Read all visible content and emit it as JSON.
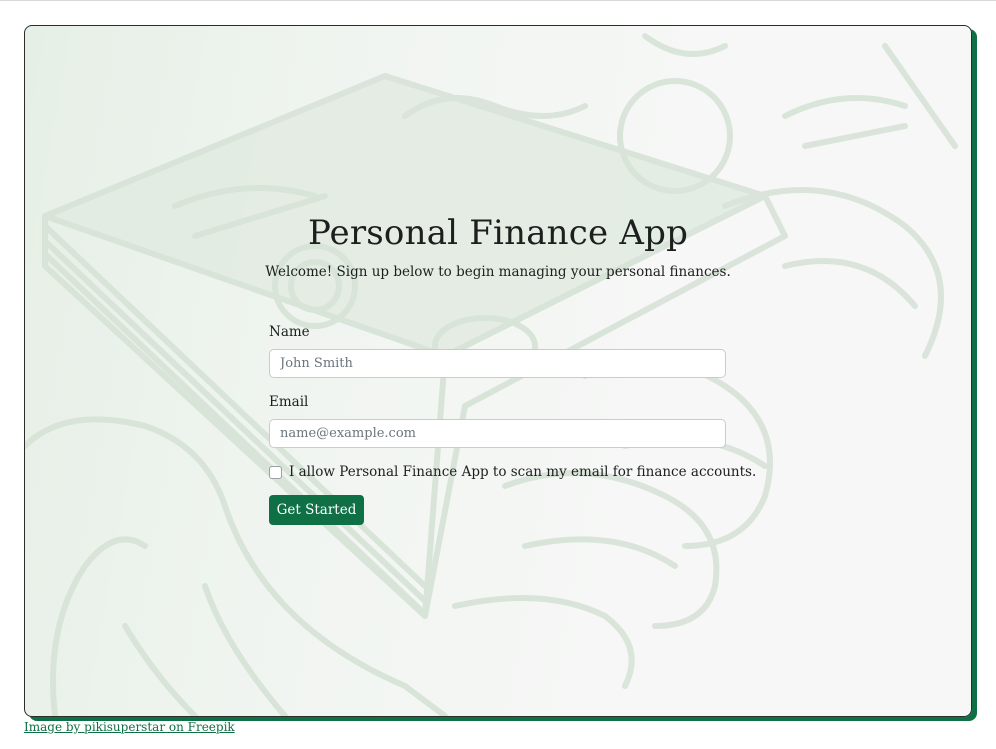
{
  "header": {
    "title": "Personal Finance App",
    "subtitle": "Welcome! Sign up below to begin managing your personal finances."
  },
  "form": {
    "name_label": "Name",
    "name_placeholder": "John Smith",
    "name_value": "",
    "email_label": "Email",
    "email_placeholder": "name@example.com",
    "email_value": "",
    "consent_label": "I allow Personal Finance App to scan my email for finance accounts.",
    "consent_checked": false,
    "submit_label": "Get Started"
  },
  "footer": {
    "credit_text": "Image by pikisuperstar on Freepik"
  },
  "colors": {
    "accent": "#0f7045",
    "card_border": "#2c2c2c",
    "text": "#1c1f1d",
    "background_art": "#dfe8df"
  },
  "background": {
    "illustration": "money-stack-in-hand"
  }
}
